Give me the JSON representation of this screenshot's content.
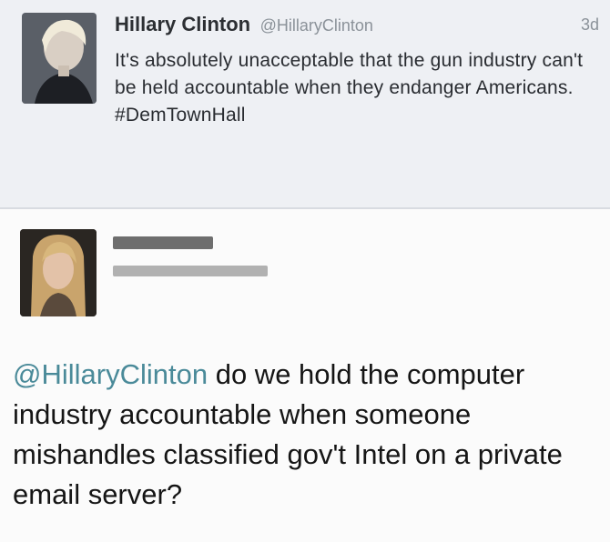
{
  "tweet": {
    "author_name": "Hillary Clinton",
    "author_handle": "@HillaryClinton",
    "timestamp": "3d",
    "text": "It's absolutely unacceptable that the gun industry can't be held accountable when they endanger Americans.",
    "hashtag": "#DemTownHall"
  },
  "reply": {
    "mention": "@HillaryClinton",
    "text": " do we hold the computer industry accountable when someone mishandles classified gov't Intel on a private email server?"
  },
  "colors": {
    "mention_link": "#4a8a99",
    "tweet_background": "#eef0f4",
    "reply_background": "#fbfbfb"
  }
}
